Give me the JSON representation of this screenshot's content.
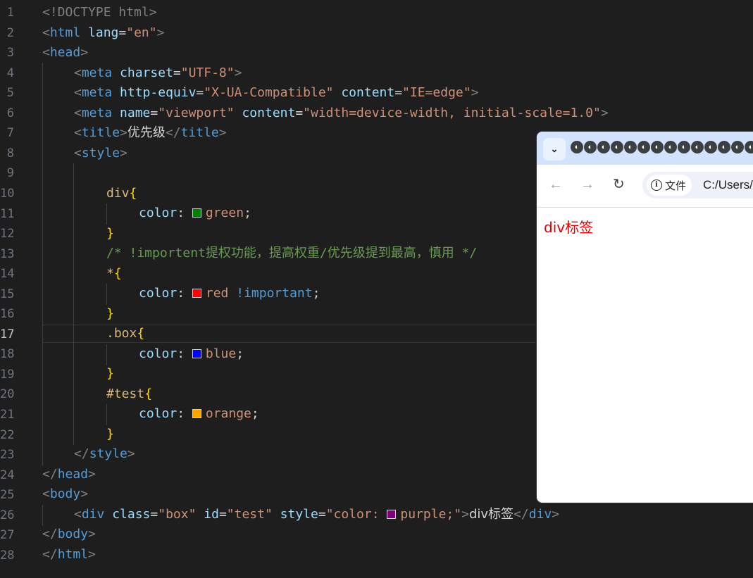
{
  "editor": {
    "active_line": 17,
    "lines": [
      {
        "n": "1"
      },
      {
        "n": "2"
      },
      {
        "n": "3"
      },
      {
        "n": "4"
      },
      {
        "n": "5"
      },
      {
        "n": "6"
      },
      {
        "n": "7"
      },
      {
        "n": "8"
      },
      {
        "n": "9"
      },
      {
        "n": "10"
      },
      {
        "n": "11"
      },
      {
        "n": "12"
      },
      {
        "n": "13"
      },
      {
        "n": "14"
      },
      {
        "n": "15"
      },
      {
        "n": "16"
      },
      {
        "n": "17"
      },
      {
        "n": "18"
      },
      {
        "n": "19"
      },
      {
        "n": "20"
      },
      {
        "n": "21"
      },
      {
        "n": "22"
      },
      {
        "n": "23"
      },
      {
        "n": "24"
      },
      {
        "n": "25"
      },
      {
        "n": "26"
      },
      {
        "n": "27"
      },
      {
        "n": "28"
      }
    ],
    "code": {
      "doctype": "<!DOCTYPE html>",
      "html_lang_value": "\"en\"",
      "charset_value": "\"UTF-8\"",
      "http_equiv_value": "\"X-UA-Compatible\"",
      "content_ie_value": "\"IE=edge\"",
      "name_value": "\"viewport\"",
      "content_vp_value": "\"width=device-width, initial-scale=1.0\"",
      "title_text": "优先级",
      "comment": "/* !importent提权功能，提高权重/优先级提到最高，慎用 */",
      "rules": [
        {
          "selector": "div",
          "prop": "color",
          "value": "green",
          "swatch": "#008000",
          "important": ""
        },
        {
          "selector": "*",
          "prop": "color",
          "value": "red",
          "swatch": "#ff0000",
          "important": "!important"
        },
        {
          "selector": ".box",
          "prop": "color",
          "value": "blue",
          "swatch": "#0000ff",
          "important": ""
        },
        {
          "selector": "#test",
          "prop": "color",
          "value": "orange",
          "swatch": "#ffa500",
          "important": ""
        }
      ],
      "body_div": {
        "class_value": "\"box\"",
        "id_value": "\"test\"",
        "style_open": "\"color: ",
        "style_value": "purple;\"",
        "swatch": "#800080",
        "text": "div标签"
      }
    }
  },
  "browser": {
    "tab_dropdown_icon": "chevron-down-icon",
    "tab_count": 14,
    "nav": {
      "back": "←",
      "forward": "→",
      "reload": "↻"
    },
    "security_chip_label": "文件",
    "url": "C:/Users/",
    "page_text": "div标签",
    "page_text_color": "#e00000"
  }
}
